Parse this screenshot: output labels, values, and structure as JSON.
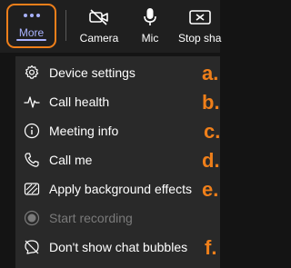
{
  "toolbar": {
    "more_label": "More",
    "camera_label": "Camera",
    "mic_label": "Mic",
    "stop_label": "Stop sha"
  },
  "menu": {
    "items": [
      {
        "label": "Device settings",
        "icon": "gear-icon",
        "enabled": true
      },
      {
        "label": "Call health",
        "icon": "pulse-icon",
        "enabled": true
      },
      {
        "label": "Meeting info",
        "icon": "info-icon",
        "enabled": true
      },
      {
        "label": "Call me",
        "icon": "phone-icon",
        "enabled": true
      },
      {
        "label": "Apply background effects",
        "icon": "background-effects-icon",
        "enabled": true
      },
      {
        "label": "Start recording",
        "icon": "record-icon",
        "enabled": false
      },
      {
        "label": "Don't show chat bubbles",
        "icon": "chat-bubble-off-icon",
        "enabled": true
      }
    ]
  },
  "annotations": [
    "a.",
    "b.",
    "c.",
    "d.",
    "e.",
    "f."
  ],
  "colors": {
    "highlight": "#ef7f1a",
    "accent": "#a8b2ff",
    "menu_bg": "#292929",
    "toolbar_bg": "#1f1f1f"
  }
}
